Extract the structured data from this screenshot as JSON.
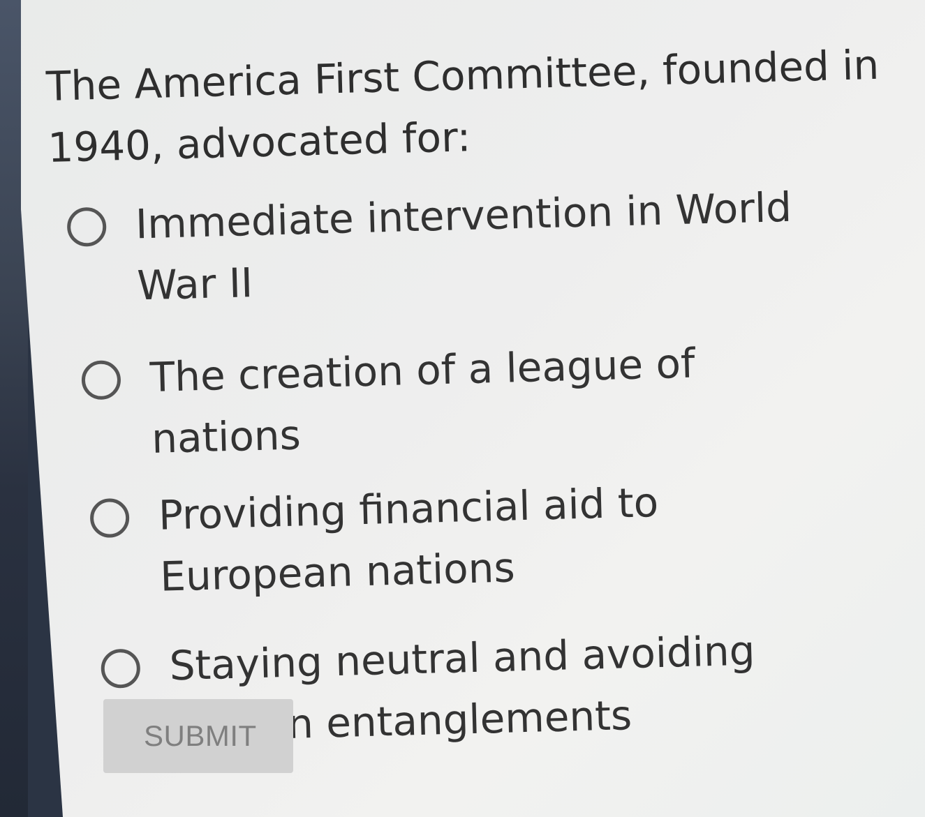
{
  "question": {
    "text": "The America First Committee, founded in 1940, advocated for:"
  },
  "options": [
    {
      "label": "Immediate intervention in World War II",
      "selected": false
    },
    {
      "label": "The creation of a league of nations",
      "selected": false
    },
    {
      "label": "Providing financial aid to European nations",
      "selected": false
    },
    {
      "label": "Staying neutral and avoiding foreign entanglements",
      "selected": false
    }
  ],
  "submit": {
    "label": "SUBMIT",
    "enabled": false
  },
  "colors": {
    "text": "#333333",
    "radio_border": "#555555",
    "button_bg": "#d1d1d1",
    "button_text": "#7f7f7f",
    "panel_bg": "#eeeeee"
  }
}
